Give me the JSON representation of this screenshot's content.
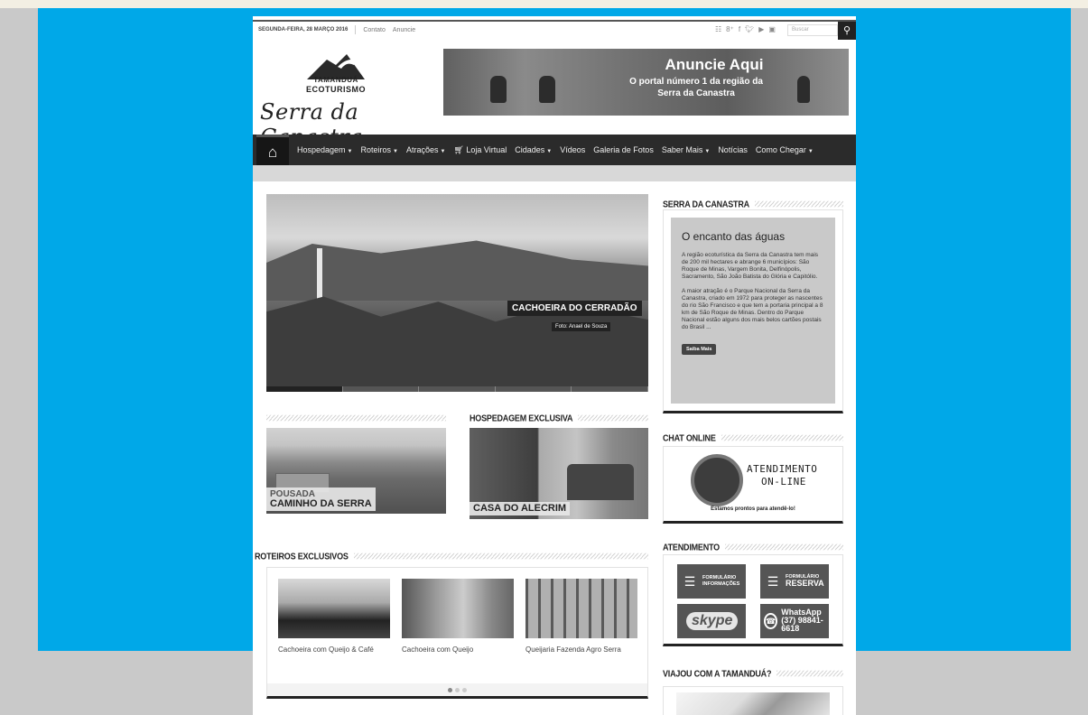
{
  "topbar": {
    "date": "SEGUNDA-FEIRA, 28 MARÇO 2016",
    "links": [
      "Contato",
      "Anuncie"
    ],
    "search_placeholder": "Buscar"
  },
  "logo": {
    "brand_line1": "TAMANDUÁ",
    "brand_line2": "ECOTURISMO",
    "script": "Serra da Canastra"
  },
  "banner": {
    "title": "Anuncie Aqui",
    "line1": "O portal número 1 da região da",
    "line2": "Serra da Canastra"
  },
  "nav": {
    "items": [
      {
        "label": "Hospedagem",
        "dropdown": true
      },
      {
        "label": "Roteiros",
        "dropdown": true
      },
      {
        "label": "Atrações",
        "dropdown": true
      },
      {
        "label": "Loja Virtual",
        "dropdown": false
      },
      {
        "label": "Cidades",
        "dropdown": true
      },
      {
        "label": "Vídeos",
        "dropdown": false
      },
      {
        "label": "Galeria de Fotos",
        "dropdown": false
      },
      {
        "label": "Saber Mais",
        "dropdown": true
      },
      {
        "label": "Notícias",
        "dropdown": false
      },
      {
        "label": "Como Chegar",
        "dropdown": true
      }
    ]
  },
  "slider": {
    "caption": "CACHOEIRA DO CERRADÃO",
    "credit": "Foto: Anael de Souza"
  },
  "featured": {
    "left": {
      "small": "POUSADA",
      "big": "CAMINHO DA SERRA"
    },
    "right_title": "HOSPEDAGEM EXCLUSIVA",
    "right": {
      "big": "CASA DO ALECRIM"
    }
  },
  "roteiros": {
    "title": "ROTEIROS EXCLUSIVOS",
    "items": [
      "Cachoeira com Queijo & Café",
      "Cachoeira com Queijo",
      "Queijaria Fazenda Agro Serra"
    ]
  },
  "sidebar": {
    "canastra_title": "SERRA DA CANASTRA",
    "canastra_heading": "O encanto das águas",
    "canastra_p1": "A região ecoturística da Serra da Canastra tem mais de 200 mil hectares e abrange 6 municípios: São Roque de Minas, Vargem Bonita, Delfinópolis, Sacramento, São João Batista do Glória e Capitólio.",
    "canastra_p2": "A maior atração é o Parque Nacional da Serra da Canastra, criado em 1972 para proteger as nascentes do rio São Francisco e que tem a portaria principal a 8 km de São Roque de Minas. Dentro do Parque Nacional estão alguns dos mais belos cartões postais do Brasil ...",
    "canastra_btn": "Saiba Mais",
    "chat_title": "CHAT ONLINE",
    "chat_line1": "ATENDIMENTO",
    "chat_line2": "ON-LINE",
    "chat_ready": "Estamos prontos para atendê-lo!",
    "atend_title": "ATENDIMENTO",
    "form1_small": "FORMULÁRIO",
    "form1_big": "INFORMAÇÕES",
    "form2_small": "FORMULÁRIO",
    "form2_big": "RESERVA",
    "skype": "skype",
    "wa_name": "WhatsApp",
    "wa_number": "(37) 98841-6618",
    "viajou_title": "VIAJOU COM A TAMANDUÁ?"
  }
}
